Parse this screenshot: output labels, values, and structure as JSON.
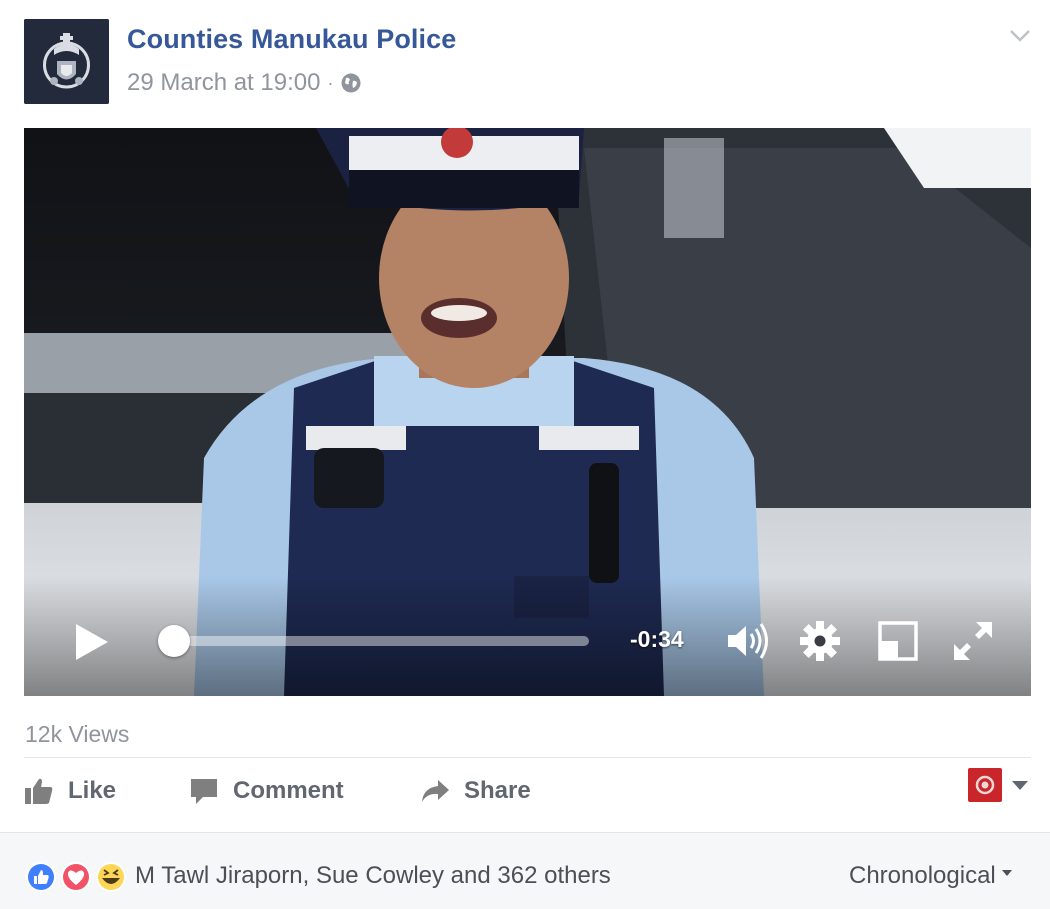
{
  "post": {
    "page_name": "Counties Manukau Police",
    "timestamp": "29 March at 19:00",
    "separator": "·",
    "privacy_icon": "globe-icon",
    "menu_icon": "chevron-down-icon"
  },
  "video": {
    "time_remaining": "-0:34",
    "progress": 0.03,
    "controls": [
      "play-icon",
      "volume-icon",
      "gear-icon",
      "picture-in-picture-icon",
      "fullscreen-icon"
    ]
  },
  "stats": {
    "views": "12k Views"
  },
  "actions": {
    "like_label": "Like",
    "comment_label": "Comment",
    "share_label": "Share"
  },
  "reactions": {
    "icons": [
      "like-reaction-icon",
      "love-reaction-icon",
      "haha-reaction-icon"
    ],
    "names": "M Tawl Jiraporn, Sue Cowley and 362 others",
    "sort_label": "Chronological"
  },
  "colors": {
    "link_blue": "#365899",
    "meta_gray": "#90949c",
    "action_gray": "#606770",
    "like_blue": "#4080ff",
    "love_red": "#f25268",
    "haha_yellow": "#fcd654"
  }
}
